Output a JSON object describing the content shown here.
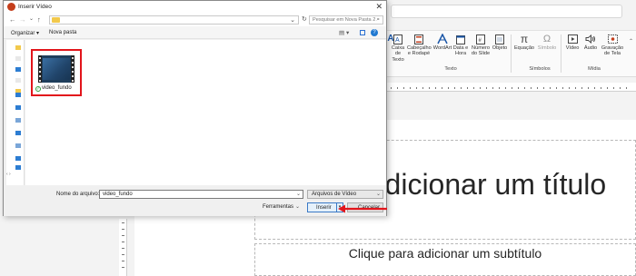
{
  "dialog": {
    "title": "Inserir Vídeo",
    "close": "✕",
    "nav": {
      "back": "←",
      "forward": "→",
      "dropdown": "⌄",
      "up": "↑",
      "address_chevron": "⌄",
      "refresh": "↻"
    },
    "search_placeholder": "Pesquisar em Nova Pasta 2",
    "toolbar": {
      "organize": "Organizar ▾",
      "new_folder": "Nova pasta",
      "view": "▤ ▾",
      "help": "?"
    },
    "file": {
      "name": "video_fundo",
      "highlight_color": "#e2151b"
    },
    "filename_label": "Nome do arquivo:",
    "filename_value": "video_fundo",
    "filetype": "Arquivos de Vídeo",
    "tools": "Ferramentas",
    "insert": "Inserir",
    "cancel": "Cancelar",
    "chevron": "⌄"
  },
  "ribbon": {
    "items": [
      {
        "label": "Caixa de Texto",
        "icon": "A"
      },
      {
        "label": "Cabeçalho e Rodapé",
        "icon": "▤"
      },
      {
        "label": "WordArt",
        "icon": "A"
      },
      {
        "label": "Data e Hora",
        "icon": "▦"
      },
      {
        "label": "Número do Slide",
        "icon": "#"
      },
      {
        "label": "Objeto",
        "icon": "▭"
      },
      {
        "label": "Equação",
        "icon": "π"
      },
      {
        "label": "Símbolo",
        "icon": "Ω"
      },
      {
        "label": "Vídeo",
        "icon": "▶"
      },
      {
        "label": "Áudio",
        "icon": "🔊"
      },
      {
        "label": "Gravação de Tela",
        "icon": "⬚"
      }
    ],
    "groups": {
      "text": "Texto",
      "symbols": "Símbolos",
      "media": "Mídia"
    },
    "collapse": "⌃"
  },
  "slide": {
    "title": "para adicionar um título",
    "subtitle": "Clique para adicionar um subtítulo"
  },
  "accent_color": "#c43e1c"
}
